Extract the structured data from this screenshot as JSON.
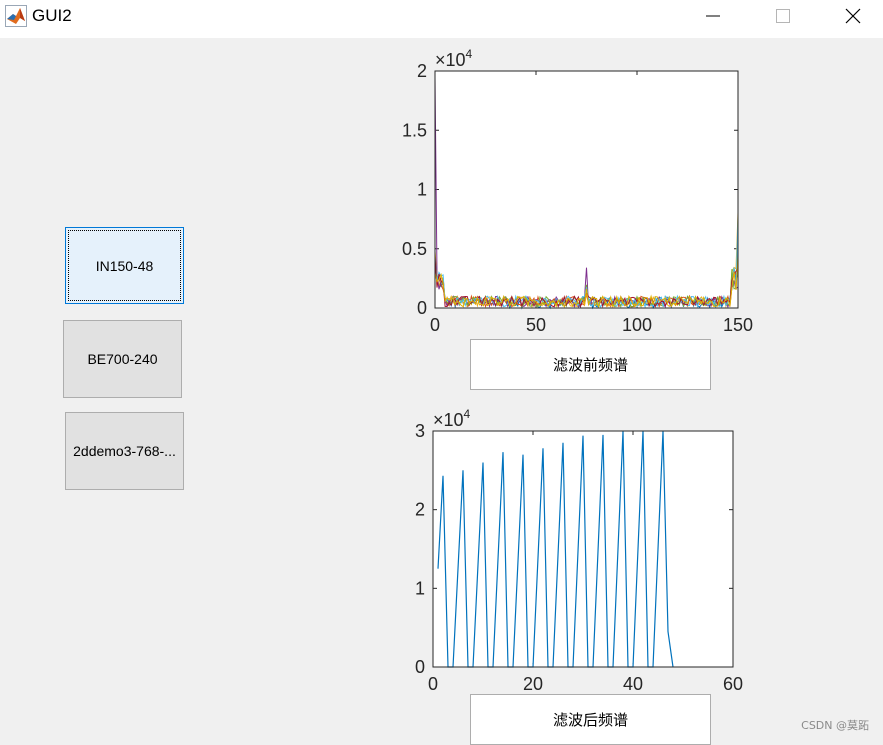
{
  "window": {
    "title": "GUI2",
    "minimize_icon": "minimize-icon",
    "maximize_icon": "maximize-icon",
    "close_icon": "close-icon"
  },
  "buttons": [
    {
      "label": "IN150-48",
      "focused": true
    },
    {
      "label": "BE700-240",
      "focused": false
    },
    {
      "label": "2ddemo3-768-...",
      "focused": false
    }
  ],
  "labels": {
    "before": "滤波前频谱",
    "after": "滤波后频谱"
  },
  "watermark": "CSDN @莫跖",
  "colors": {
    "series_blue": "#0072bd",
    "plot_bg": "#ffffff",
    "figure_bg": "#f0f0f0"
  },
  "chart_data": [
    {
      "type": "line",
      "title": "",
      "xlabel": "",
      "ylabel": "",
      "exponent": "×10^4",
      "xlim": [
        0,
        150
      ],
      "ylim": [
        0,
        2
      ],
      "xticks": [
        0,
        50,
        100,
        150
      ],
      "yticks": [
        0,
        0.5,
        1,
        1.5,
        2
      ],
      "xtick_labels": [
        "0",
        "50",
        "100",
        "150"
      ],
      "ytick_labels": [
        "0",
        "0.5",
        "1",
        "1.5",
        "2"
      ],
      "series_count": 8,
      "series_colors": [
        "#0072bd",
        "#d95319",
        "#edb120",
        "#7e2f8e",
        "#77ac30",
        "#4dbeee",
        "#a2142f",
        "#e0b000"
      ],
      "peak_start": 1.95,
      "noise_level": 0.09,
      "center_spike": {
        "x": 75,
        "y": 0.34
      }
    },
    {
      "type": "line",
      "title": "",
      "xlabel": "",
      "ylabel": "",
      "exponent": "×10^4",
      "xlim": [
        0,
        60
      ],
      "ylim": [
        0,
        3
      ],
      "xticks": [
        0,
        20,
        40,
        60
      ],
      "yticks": [
        0,
        1,
        2,
        3
      ],
      "xtick_labels": [
        "0",
        "20",
        "40",
        "60"
      ],
      "ytick_labels": [
        "0",
        "1",
        "2",
        "3"
      ],
      "series": [
        {
          "x": [
            1,
            2,
            3,
            4,
            5,
            6,
            7,
            8,
            9,
            10,
            11,
            12,
            13,
            14,
            15,
            16,
            17,
            18,
            19,
            20,
            21,
            22,
            23,
            24,
            25,
            26,
            27,
            28,
            29,
            30,
            31,
            32,
            33,
            34,
            35,
            36,
            37,
            38,
            39,
            40,
            41,
            42,
            43,
            44,
            45,
            46,
            47,
            48
          ],
          "values": [
            1.25,
            2.43,
            0,
            0,
            1.25,
            2.5,
            0,
            0,
            1.3,
            2.6,
            0,
            0,
            1.37,
            2.73,
            0,
            0,
            1.35,
            2.7,
            0,
            0,
            1.39,
            2.78,
            0,
            0,
            1.42,
            2.85,
            0,
            0,
            1.47,
            2.94,
            0,
            0,
            1.47,
            2.95,
            0,
            0,
            1.5,
            3.0,
            0,
            0,
            1.5,
            3.0,
            0,
            0,
            1.5,
            3.0,
            0.45,
            0
          ]
        }
      ]
    }
  ]
}
